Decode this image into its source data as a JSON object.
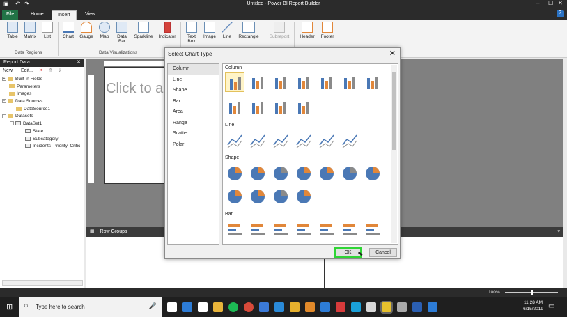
{
  "app": {
    "title": "Untitled - Power BI Report Builder"
  },
  "tabs": [
    {
      "label": "File"
    },
    {
      "label": "Home"
    },
    {
      "label": "Insert"
    },
    {
      "label": "View"
    }
  ],
  "ribbon": {
    "data_regions": {
      "group_label": "Data Regions",
      "items": [
        "Table",
        "Matrix",
        "List"
      ]
    },
    "data_visualizations": {
      "group_label": "Data Visualizations",
      "items": [
        "Chart",
        "Gauge",
        "Map",
        "Data Bar",
        "Sparkline",
        "Indicator"
      ]
    },
    "other_items": [
      "Text Box",
      "Image",
      "Line",
      "Rectangle",
      "Subreport",
      "Header",
      "Footer"
    ]
  },
  "report_data": {
    "title": "Report Data",
    "toolbar": {
      "new": "New",
      "edit": "Edit..."
    },
    "tree": [
      {
        "label": "Built-in Fields",
        "level": 0,
        "icon": "folder-icon"
      },
      {
        "label": "Parameters",
        "level": 0,
        "icon": "folder-icon"
      },
      {
        "label": "Images",
        "level": 0,
        "icon": "folder-icon"
      },
      {
        "label": "Data Sources",
        "level": 0,
        "icon": "folder-icon"
      },
      {
        "label": "DataSource1",
        "level": 1,
        "icon": "datasource-icon"
      },
      {
        "label": "Datasets",
        "level": 0,
        "icon": "folder-icon"
      },
      {
        "label": "DataSet1",
        "level": 1,
        "icon": "dataset-icon"
      },
      {
        "label": "State",
        "level": 2,
        "icon": "field-icon"
      },
      {
        "label": "Subcategory",
        "level": 2,
        "icon": "field-icon"
      },
      {
        "label": "Incidents_Priority_Critic",
        "level": 2,
        "icon": "field-icon"
      }
    ]
  },
  "design": {
    "click_to": "Click to a",
    "row_groups": "Row Groups"
  },
  "dialog": {
    "title": "Select Chart Type",
    "categories": [
      "Column",
      "Line",
      "Shape",
      "Bar",
      "Area",
      "Range",
      "Scatter",
      "Polar"
    ],
    "selected_category": "Column",
    "sections": [
      {
        "name": "Column",
        "count": 11
      },
      {
        "name": "Line",
        "count": 6
      },
      {
        "name": "Shape",
        "count": 11
      },
      {
        "name": "Bar",
        "count": 7
      }
    ],
    "ok": "OK",
    "cancel": "Cancel"
  },
  "status": {
    "zoom": "100%"
  },
  "taskbar": {
    "search_placeholder": "Type here to search",
    "time": "11:28 AM",
    "date": "6/15/2019"
  },
  "colors": {
    "accent_blue": "#4a78b5",
    "accent_orange": "#e1873a",
    "gray": "#8a8a8a",
    "highlight_green": "#2fd535"
  }
}
